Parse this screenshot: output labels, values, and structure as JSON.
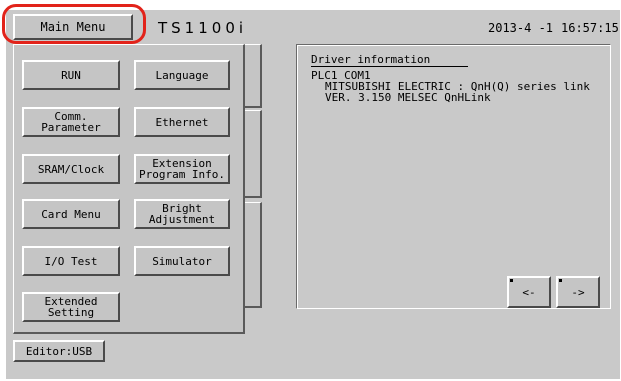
{
  "header": {
    "main_menu_label": "Main Menu",
    "title": "TS1100i",
    "date": "2013-4 -1",
    "time": "16:57:15"
  },
  "menu": {
    "run": "RUN",
    "language": "Language",
    "comm_parameter": "Comm.\nParameter",
    "ethernet": "Ethernet",
    "sram_clock": "SRAM/Clock",
    "extension_program_info": "Extension\nProgram Info.",
    "card_menu": "Card Menu",
    "bright_adjustment": "Bright\nAdjustment",
    "io_test": "I/O Test",
    "simulator": "Simulator",
    "extended_setting": "Extended\nSetting"
  },
  "editor_button": "Editor:USB",
  "driver_info": {
    "title": "Driver information",
    "line1": "PLC1 COM1",
    "line2": "MITSUBISHI ELECTRIC : QnH(Q) series link",
    "line3": "VER. 3.150 MELSEC QnHLink"
  },
  "nav": {
    "prev": "<-",
    "next": "->"
  },
  "colors": {
    "highlight": "#e2231a",
    "screen_bg": "#c9c9c9"
  }
}
